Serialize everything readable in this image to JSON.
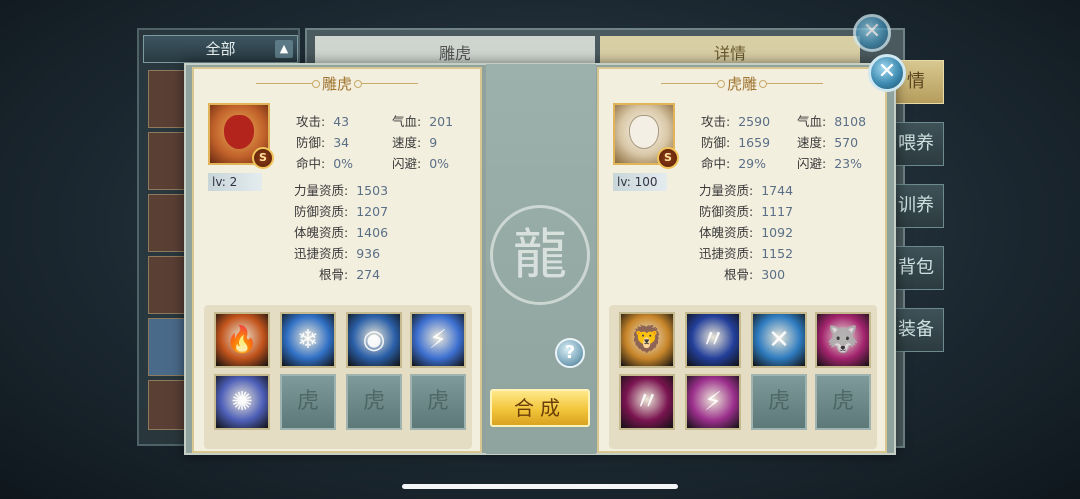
{
  "background": {
    "filter_label": "全部",
    "header_left": "雕虎",
    "header_right": "详情",
    "side_tabs": [
      "情",
      "喂养",
      "训养",
      "背包",
      "装备"
    ]
  },
  "dialog": {
    "help_label": "?",
    "merge_label": "合成",
    "close_label": "✕",
    "emblem": "龍",
    "left": {
      "name": "雕虎",
      "rank": "S",
      "level": "lv: 2",
      "stats": [
        {
          "label": "攻击:",
          "value": "43"
        },
        {
          "label": "气血:",
          "value": "201"
        },
        {
          "label": "防御:",
          "value": "34"
        },
        {
          "label": "速度:",
          "value": "9"
        },
        {
          "label": "命中:",
          "value": "0%"
        },
        {
          "label": "闪避:",
          "value": "0%"
        }
      ],
      "aptitudes": [
        {
          "label": "力量资质:",
          "value": "1503"
        },
        {
          "label": "防御资质:",
          "value": "1207"
        },
        {
          "label": "体魄资质:",
          "value": "1406"
        },
        {
          "label": "迅捷资质:",
          "value": "936"
        },
        {
          "label": "根骨:",
          "value": "274"
        }
      ],
      "skills": [
        {
          "icon": "fire-phoenix-skill-icon",
          "glyph": "🔥",
          "color": "#c2541c"
        },
        {
          "icon": "ice-beast-skill-icon",
          "glyph": "❄",
          "color": "#2f6fc4"
        },
        {
          "icon": "water-orb-skill-icon",
          "glyph": "◉",
          "color": "#2a5fa8"
        },
        {
          "icon": "lightning-slash-skill-icon",
          "glyph": "⚡",
          "color": "#3c6fd0"
        },
        {
          "icon": "vortex-skill-icon",
          "glyph": "✺",
          "color": "#4d5fb8"
        },
        {
          "icon": "empty-slot-icon",
          "glyph": "虎",
          "color": ""
        },
        {
          "icon": "empty-slot-icon",
          "glyph": "虎",
          "color": ""
        },
        {
          "icon": "empty-slot-icon",
          "glyph": "虎",
          "color": ""
        }
      ]
    },
    "right": {
      "name": "虎雕",
      "rank": "S",
      "level": "lv: 100",
      "stats": [
        {
          "label": "攻击:",
          "value": "2590"
        },
        {
          "label": "气血:",
          "value": "8108"
        },
        {
          "label": "防御:",
          "value": "1659"
        },
        {
          "label": "速度:",
          "value": "570"
        },
        {
          "label": "命中:",
          "value": "29%"
        },
        {
          "label": "闪避:",
          "value": "23%"
        }
      ],
      "aptitudes": [
        {
          "label": "力量资质:",
          "value": "1744"
        },
        {
          "label": "防御资质:",
          "value": "1117"
        },
        {
          "label": "体魄资质:",
          "value": "1092"
        },
        {
          "label": "迅捷资质:",
          "value": "1152"
        },
        {
          "label": "根骨:",
          "value": "300"
        }
      ],
      "skills": [
        {
          "icon": "lion-roar-skill-icon",
          "glyph": "🦁",
          "color": "#c8862a"
        },
        {
          "icon": "blue-claw-skill-icon",
          "glyph": "〃",
          "color": "#233f9a"
        },
        {
          "icon": "cross-blades-skill-icon",
          "glyph": "✕",
          "color": "#2e7bbf"
        },
        {
          "icon": "purple-wolf-skill-icon",
          "glyph": "🐺",
          "color": "#a3246e"
        },
        {
          "icon": "pink-claw-skill-icon",
          "glyph": "〃",
          "color": "#7a1450"
        },
        {
          "icon": "purple-lightning-skill-icon",
          "glyph": "⚡",
          "color": "#9b2f8c"
        },
        {
          "icon": "empty-slot-icon",
          "glyph": "虎",
          "color": ""
        },
        {
          "icon": "empty-slot-icon",
          "glyph": "虎",
          "color": ""
        }
      ]
    }
  }
}
